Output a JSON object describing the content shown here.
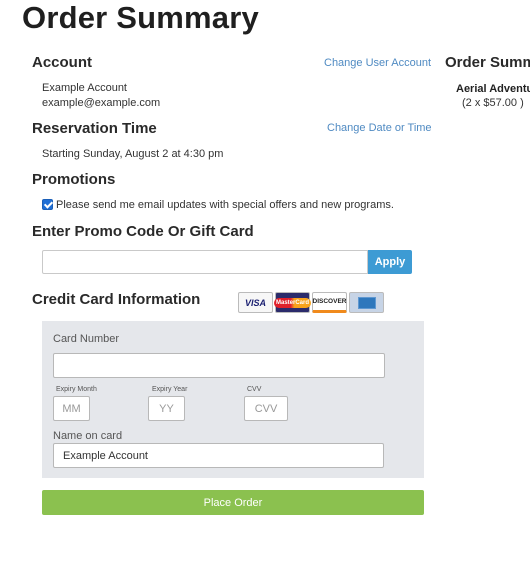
{
  "page": {
    "title": "Order Summary"
  },
  "account": {
    "heading": "Account",
    "change_link": "Change User Account",
    "name": "Example Account",
    "email": "example@example.com"
  },
  "reservation": {
    "heading": "Reservation Time",
    "change_link": "Change Date or Time",
    "start_text": "Starting Sunday, August 2 at 4:30 pm"
  },
  "promotions": {
    "heading": "Promotions",
    "checkbox_checked": true,
    "checkbox_label": "Please send me email updates with special offers and new programs."
  },
  "promo_code": {
    "heading": "Enter Promo Code Or Gift Card",
    "input_value": "",
    "apply_label": "Apply"
  },
  "credit_card": {
    "heading": "Credit Card Information",
    "brands": [
      "VISA",
      "MasterCard",
      "DISCOVER",
      "AMEX"
    ],
    "card_number_label": "Card Number",
    "card_number_value": "",
    "expiry_month_label": "Expiry Month",
    "expiry_month_placeholder": "MM",
    "expiry_year_label": "Expiry Year",
    "expiry_year_placeholder": "YY",
    "cvv_label": "CVV",
    "cvv_placeholder": "CVV",
    "name_label": "Name on card",
    "name_value": "Example Account"
  },
  "actions": {
    "place_order_label": "Place Order"
  },
  "order_summary_panel": {
    "heading": "Order Summ",
    "item_name": "Aerial Adventu",
    "item_qty_price": "(2 x $57.00 )"
  },
  "colors": {
    "link": "#4f8ac2",
    "apply_button": "#3d9bd4",
    "place_order_button": "#8bc14f",
    "card_panel": "#e5e7eb"
  }
}
